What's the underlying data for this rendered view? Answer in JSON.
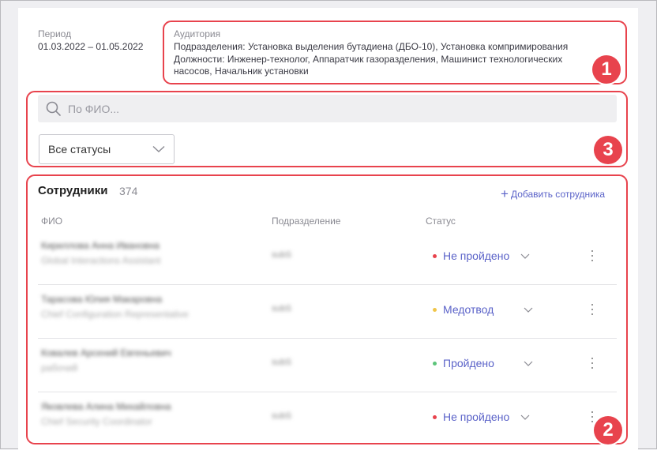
{
  "period": {
    "label": "Период",
    "value": "01.03.2022 – 01.05.2022"
  },
  "audience": {
    "label": "Аудитория",
    "line1": "Подразделения: Установка выделения бутадиена (ДБО-10), Установка компримирования",
    "line2": "Должности: Инженер-технолог, Аппаратчик газоразделения, Машинист технологических",
    "line3": "насосов, Начальник установки"
  },
  "search": {
    "placeholder": "По ФИО..."
  },
  "filter": {
    "selected": "Все статусы"
  },
  "employees": {
    "title": "Сотрудники",
    "count": "374",
    "add_label": "Добавить сотрудника",
    "columns": {
      "name": "ФИО",
      "dept": "Подразделение",
      "status": "Статус"
    },
    "rows": [
      {
        "name": "Кириллова Анна Ивановна",
        "position": "Global Interactions Assistant",
        "dept": "subS",
        "status": "Не пройдено",
        "status_color": "#e8434d"
      },
      {
        "name": "Тарасова Юлия Макаровна",
        "position": "Chief Configuration Representative",
        "dept": "subS",
        "status": "Медотвод",
        "status_color": "#f0c54a"
      },
      {
        "name": "Ковалев Арсений Евгеньевич",
        "position": "рабочий",
        "dept": "subS",
        "status": "Пройдено",
        "status_color": "#5cc47a"
      },
      {
        "name": "Яковлева Алина Михайловна",
        "position": "Chief Security Coordinator",
        "dept": "subS",
        "status": "Не пройдено",
        "status_color": "#e8434d"
      }
    ]
  },
  "callouts": [
    "1",
    "2",
    "3"
  ],
  "colors": {
    "accent": "#5a62c8",
    "highlight": "#e8434d"
  }
}
